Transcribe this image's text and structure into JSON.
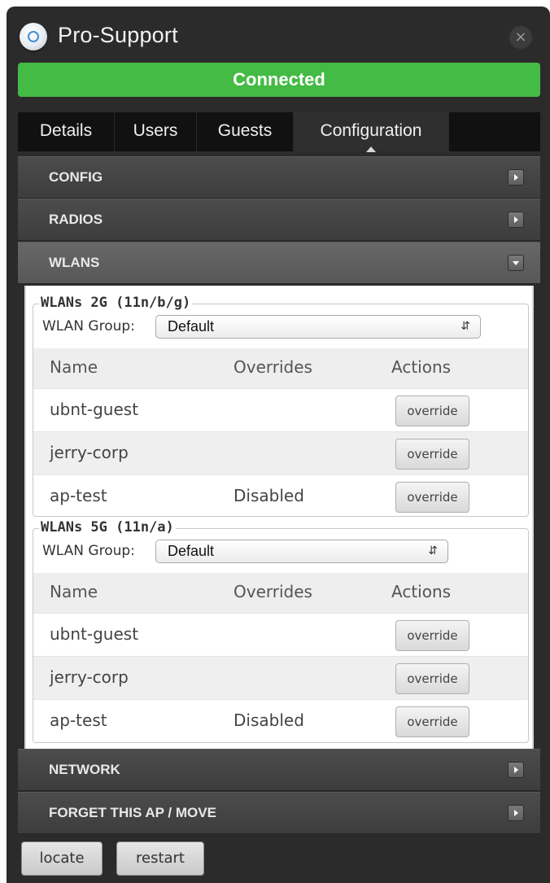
{
  "window": {
    "title": "Pro-Support",
    "close_glyph": "×",
    "status": "Connected",
    "status_color": "#44bb44",
    "icon": "access-point-icon"
  },
  "tabs": [
    {
      "label": "Details"
    },
    {
      "label": "Users"
    },
    {
      "label": "Guests"
    },
    {
      "label": "Configuration",
      "active": true
    }
  ],
  "sections": {
    "config": "CONFIG",
    "radios": "RADIOS",
    "wlans": "WLANS",
    "network": "NETWORK",
    "forget": "FORGET THIS AP / MOVE"
  },
  "wlans_2g": {
    "legend": "WLANs 2G (11n/b/g)",
    "group_label": "WLAN Group:",
    "group_value": "Default",
    "headers": {
      "name": "Name",
      "overrides": "Overrides",
      "actions": "Actions"
    },
    "rows": [
      {
        "name": "ubnt-guest",
        "overrides": "",
        "action": "override"
      },
      {
        "name": "jerry-corp",
        "overrides": "",
        "action": "override"
      },
      {
        "name": "ap-test",
        "overrides": "Disabled",
        "action": "override"
      }
    ]
  },
  "wlans_5g": {
    "legend": "WLANs 5G (11n/a)",
    "group_label": "WLAN Group:",
    "group_value": "Default",
    "headers": {
      "name": "Name",
      "overrides": "Overrides",
      "actions": "Actions"
    },
    "rows": [
      {
        "name": "ubnt-guest",
        "overrides": "",
        "action": "override"
      },
      {
        "name": "jerry-corp",
        "overrides": "",
        "action": "override"
      },
      {
        "name": "ap-test",
        "overrides": "Disabled",
        "action": "override"
      }
    ]
  },
  "footer": {
    "locate": "locate",
    "restart": "restart"
  }
}
